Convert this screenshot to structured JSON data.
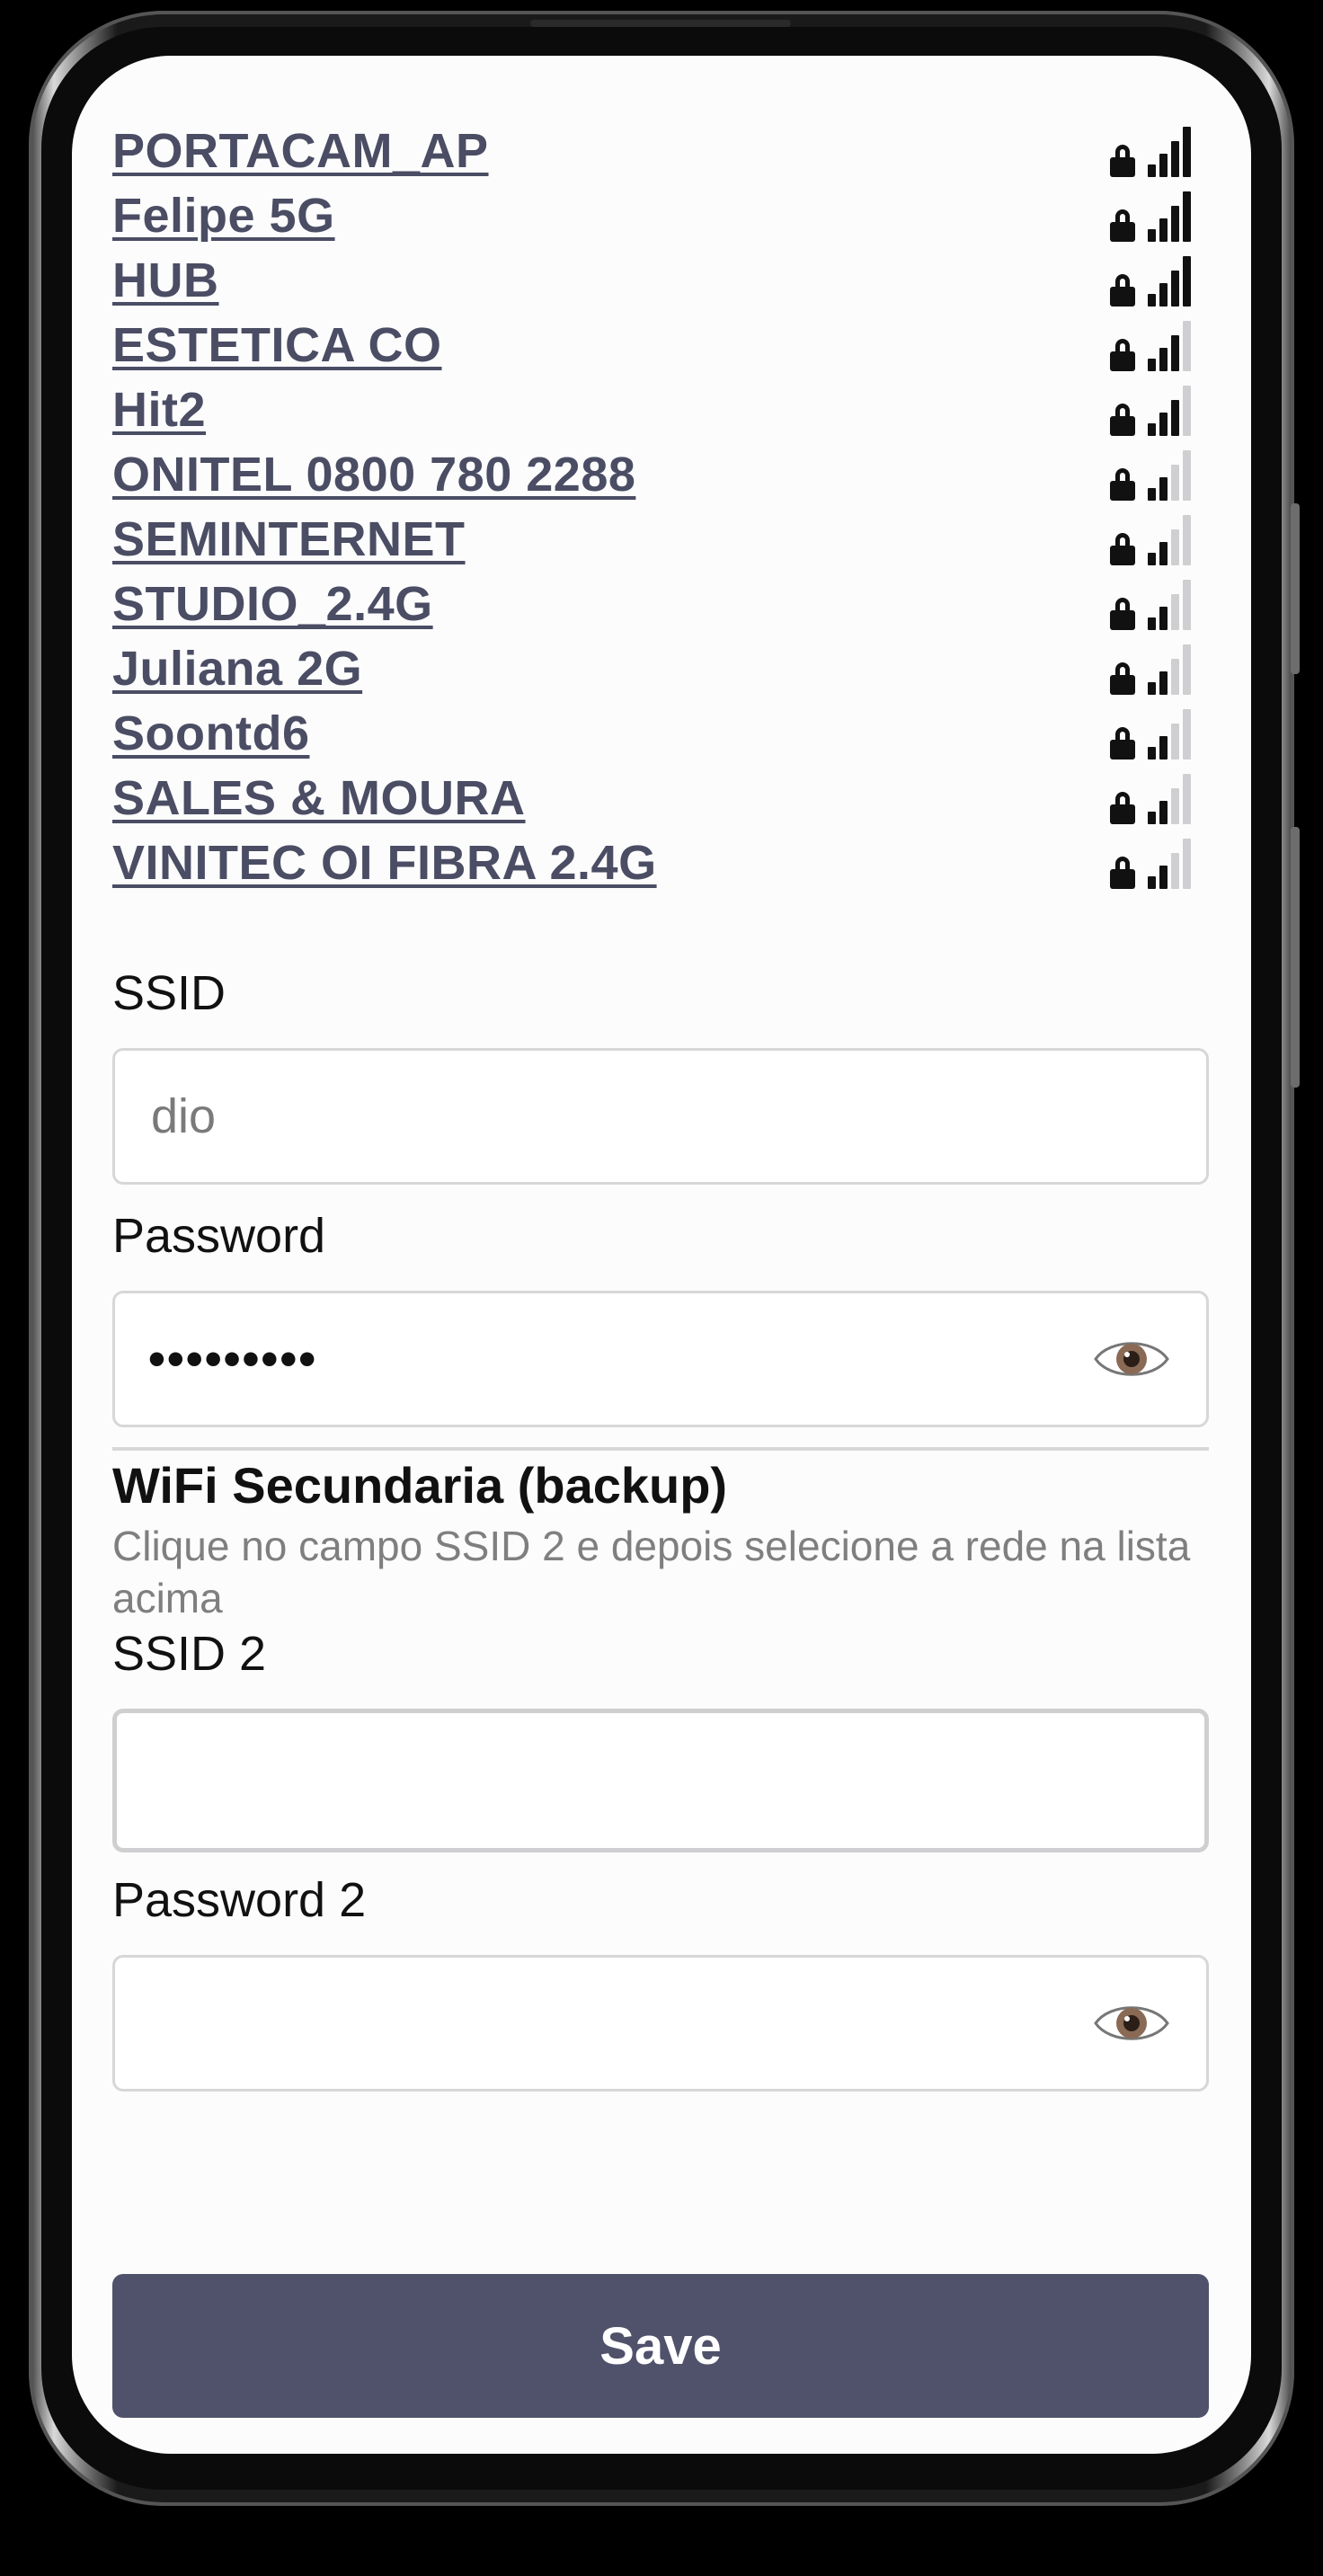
{
  "networks": [
    {
      "name": "PORTACAM_AP",
      "signal": 4,
      "secured": true
    },
    {
      "name": "Felipe 5G",
      "signal": 4,
      "secured": true
    },
    {
      "name": "HUB",
      "signal": 4,
      "secured": true
    },
    {
      "name": "ESTETICA CO",
      "signal": 3,
      "secured": true
    },
    {
      "name": "Hit2",
      "signal": 3,
      "secured": true
    },
    {
      "name": "ONITEL 0800 780 2288",
      "signal": 2,
      "secured": true
    },
    {
      "name": "SEMINTERNET",
      "signal": 2,
      "secured": true
    },
    {
      "name": "STUDIO_2.4G",
      "signal": 2,
      "secured": true
    },
    {
      "name": "Juliana 2G",
      "signal": 2,
      "secured": true
    },
    {
      "name": "Soontd6",
      "signal": 2,
      "secured": true
    },
    {
      "name": "SALES & MOURA",
      "signal": 2,
      "secured": true
    },
    {
      "name": "VINITEC OI FIBRA 2.4G",
      "signal": 2,
      "secured": true
    }
  ],
  "icons": {
    "lock": "lock-icon",
    "signal": "wifi-signal-icon",
    "eye": "eye-icon"
  },
  "form": {
    "ssid_label": "SSID",
    "ssid_value": "dio",
    "password_label": "Password",
    "password_mask": "•••••••••",
    "secondary_title": "WiFi Secundaria (backup)",
    "secondary_help": "Clique no campo SSID 2 e depois selecione a rede na lista acima",
    "ssid2_label": "SSID 2",
    "ssid2_value": "",
    "password2_label": "Password 2",
    "password2_value": "",
    "save_label": "Save"
  },
  "colors": {
    "network_link": "#4a4d63",
    "save_button": "#50526b",
    "helper_text": "#7f7f7f",
    "input_border": "#d7d7d9"
  }
}
